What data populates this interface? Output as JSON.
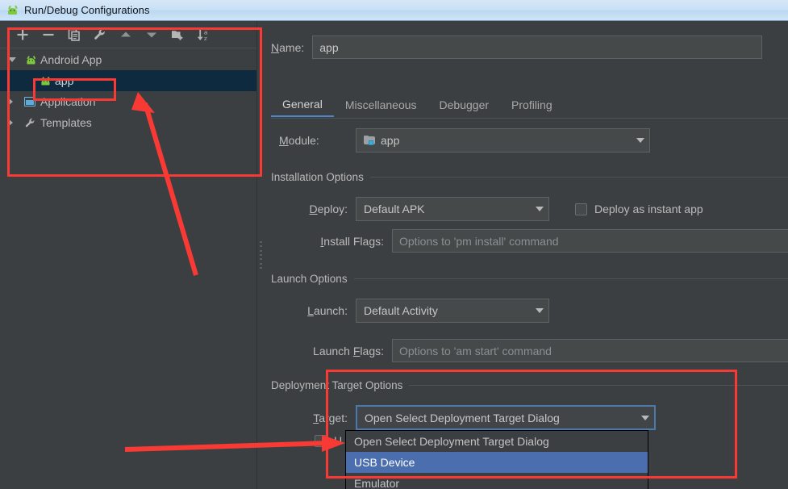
{
  "window": {
    "title": "Run/Debug Configurations",
    "title_icon": "android-icon"
  },
  "toolbar": {
    "items": [
      {
        "name": "add-button",
        "icon": "plus-icon",
        "tooltip": "Add New Configuration"
      },
      {
        "name": "remove-button",
        "icon": "minus-icon",
        "tooltip": "Remove Configuration"
      },
      {
        "name": "copy-button",
        "icon": "copy-icon",
        "tooltip": "Copy Configuration"
      },
      {
        "name": "edit-templates-button",
        "icon": "wrench-icon",
        "tooltip": "Edit Templates"
      },
      {
        "name": "move-up-button",
        "icon": "arrow-up-icon",
        "tooltip": "Move Up"
      },
      {
        "name": "move-down-button",
        "icon": "arrow-down-icon",
        "tooltip": "Move Down"
      },
      {
        "name": "new-folder-button",
        "icon": "folder-add-icon",
        "tooltip": "Create New Folder"
      },
      {
        "name": "sort-button",
        "icon": "sort-az-icon",
        "tooltip": "Sort Configurations"
      }
    ]
  },
  "tree": {
    "items": [
      {
        "label": "Android App",
        "icon": "android-icon",
        "expanded": true,
        "selected": false,
        "level": 0
      },
      {
        "label": "app",
        "icon": "android-icon",
        "expanded": null,
        "selected": true,
        "level": 1
      },
      {
        "label": "Application",
        "icon": "window-icon",
        "expanded": false,
        "selected": false,
        "level": 0
      },
      {
        "label": "Templates",
        "icon": "wrench-icon",
        "expanded": false,
        "selected": false,
        "level": 0
      }
    ]
  },
  "form": {
    "name_label": "Name:",
    "name_value": "app",
    "tabs": [
      {
        "label": "General",
        "active": true
      },
      {
        "label": "Miscellaneous",
        "active": false
      },
      {
        "label": "Debugger",
        "active": false
      },
      {
        "label": "Profiling",
        "active": false
      }
    ],
    "module_label": "Module:",
    "module_value": "app",
    "installation_options": {
      "group_title": "Installation Options",
      "deploy_label": "Deploy:",
      "deploy_value": "Default APK",
      "instant_app_label": "Deploy as instant app",
      "instant_app_checked": false,
      "install_flags_label": "Install Flags:",
      "install_flags_placeholder": "Options to 'pm install' command",
      "install_flags_value": ""
    },
    "launch_options": {
      "group_title": "Launch Options",
      "launch_label": "Launch:",
      "launch_value": "Default Activity",
      "launch_flags_label": "Launch Flags:",
      "launch_flags_placeholder": "Options to 'am start' command",
      "launch_flags_value": ""
    },
    "deployment_target_options": {
      "group_title": "Deployment Target Options",
      "target_label": "Target:",
      "target_value": "Open Select Deployment Target Dialog",
      "use_same_device_label": "U",
      "use_same_device_checked": false,
      "dropdown_open": true,
      "dropdown_options": [
        {
          "label": "Open Select Deployment Target Dialog",
          "highlighted": false
        },
        {
          "label": "USB Device",
          "highlighted": true
        },
        {
          "label": "Emulator",
          "highlighted": false
        }
      ]
    }
  },
  "colors": {
    "background": "#3c3f41",
    "title_bar": "#c9e0f5",
    "selection_tree": "#0d2a3f",
    "selection_dropdown": "#4b6eaf",
    "accent_tab": "#4a88c7",
    "annotation": "#f93a34",
    "android_green": "#7ec83f"
  }
}
